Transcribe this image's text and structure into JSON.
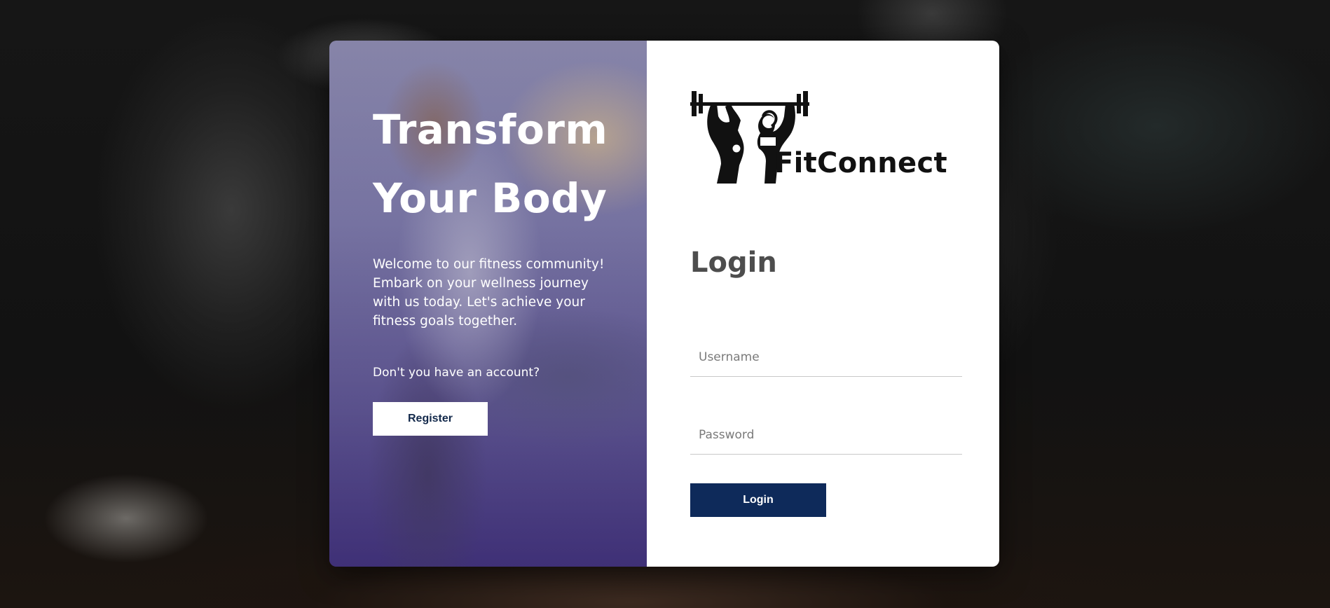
{
  "promo": {
    "title_line1": "Transform",
    "title_line2": "Your Body",
    "welcome_text": "Welcome to our fitness community! Embark on your wellness journey with us today. Let's achieve your fitness goals together.",
    "account_question": "Don't you have an account?",
    "register_label": "Register"
  },
  "brand": {
    "name": "FitConnect",
    "logo_icon": "weightlifter-barbell-icon"
  },
  "login": {
    "heading": "Login",
    "username_placeholder": "Username",
    "password_placeholder": "Password",
    "submit_label": "Login"
  },
  "colors": {
    "primary_button": "#0e2a5a",
    "register_text": "#13294b",
    "heading_text": "#4d4d4d"
  }
}
